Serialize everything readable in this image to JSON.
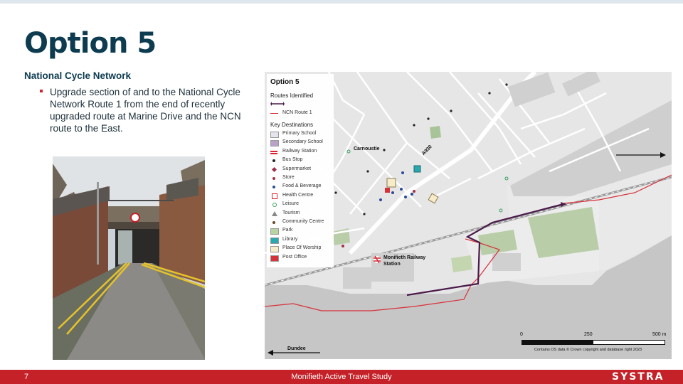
{
  "slide": {
    "title": "Option 5",
    "subtitle": "National Cycle Network",
    "bullet": "Upgrade section of and to the National Cycle Network Route 1 from the end of recently upgraded route at Marine Drive and the NCN route to the East."
  },
  "map": {
    "legend_title": "Option 5",
    "routes_heading": "Routes Identified",
    "key_heading": "Key Destinations",
    "route_item": "NCN Route 1",
    "items": [
      {
        "label": "Primary School",
        "color": "#e4e4ec",
        "icon": "square"
      },
      {
        "label": "Secondary School",
        "color": "#b8a2c8",
        "icon": "square"
      },
      {
        "label": "Railway Station",
        "color": "#d6232e",
        "icon": "rail-icon"
      },
      {
        "label": "Bus Stop",
        "color": "#222222",
        "icon": "dot"
      },
      {
        "label": "Supermarket",
        "color": "#a0304a",
        "icon": "diamond"
      },
      {
        "label": "Store",
        "color": "#a0304a",
        "icon": "dot"
      },
      {
        "label": "Food & Beverage",
        "color": "#2a4a9a",
        "icon": "dot"
      },
      {
        "label": "Health Centre",
        "color": "#d6232e",
        "icon": "cross"
      },
      {
        "label": "Leisure",
        "color": "#3aa060",
        "icon": "ring"
      },
      {
        "label": "Tourism",
        "color": "#888888",
        "icon": "triangle"
      },
      {
        "label": "Community Centre",
        "color": "#6b4a2a",
        "icon": "dot"
      },
      {
        "label": "Park",
        "color": "#b8d4a0",
        "icon": "square"
      },
      {
        "label": "Library",
        "color": "#2aa8b0",
        "icon": "square"
      },
      {
        "label": "Place Of Worship",
        "color": "#f6ecc8",
        "icon": "square"
      },
      {
        "label": "Post Office",
        "color": "#d6323a",
        "icon": "square"
      }
    ],
    "labels": {
      "carnoustie": "Carnoustie",
      "dundee": "Dundee",
      "road": "A930",
      "station": "Monifieth Railway Station"
    },
    "scale": {
      "s0": "0",
      "s1": "250",
      "s2": "500 m"
    },
    "copyright": "Contains OS data © Crown copyright and database right 2023"
  },
  "footer": {
    "page": "7",
    "title": "Monifieth Active Travel Study",
    "logo": "SYSTRA"
  },
  "colors": {
    "title": "#0d3b4f",
    "accent": "#c42128",
    "route": "#4a1a4a",
    "ncn": "#d6323a"
  }
}
